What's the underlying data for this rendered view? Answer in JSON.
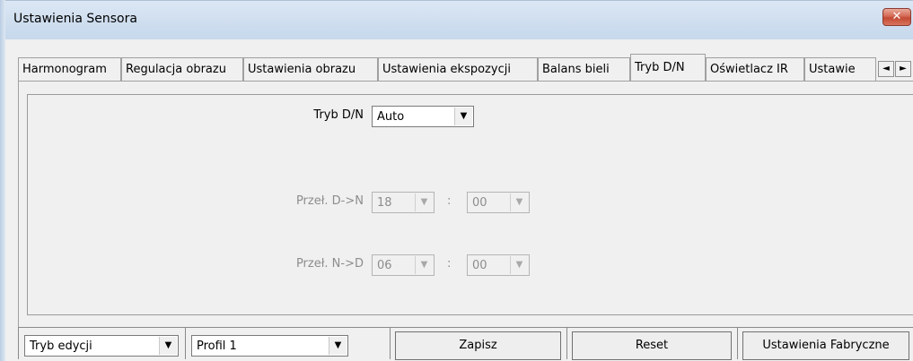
{
  "window": {
    "title": "Ustawienia Sensora",
    "close_glyph": "✕"
  },
  "tabs": [
    {
      "label": "Harmonogram"
    },
    {
      "label": "Regulacja obrazu"
    },
    {
      "label": "Ustawienia obrazu"
    },
    {
      "label": "Ustawienia ekspozycji"
    },
    {
      "label": "Balans bieli"
    },
    {
      "label": "Tryb D/N",
      "active": true
    },
    {
      "label": "Oświetlacz IR"
    },
    {
      "label": "Ustawie"
    }
  ],
  "tab_scroll": {
    "left": "◄",
    "right": "►"
  },
  "dn": {
    "mode_label": "Tryb D/N",
    "mode_value": "Auto",
    "d2n_label": "Przeł. D->N",
    "d2n_hour": "18",
    "d2n_minute": "00",
    "n2d_label": "Przeł. N->D",
    "n2d_hour": "06",
    "n2d_minute": "00",
    "colon": ":",
    "arrow": "▼"
  },
  "bottom": {
    "edit_mode_value": "Tryb edycji",
    "profile_value": "Profil 1",
    "save_label": "Zapisz",
    "reset_label": "Reset",
    "factory_label": "Ustawienia Fabryczne"
  },
  "colors": {
    "close_button": "#c24a34",
    "titlebar": "#cfdeef",
    "disabled_text": "#8d8d8d"
  }
}
